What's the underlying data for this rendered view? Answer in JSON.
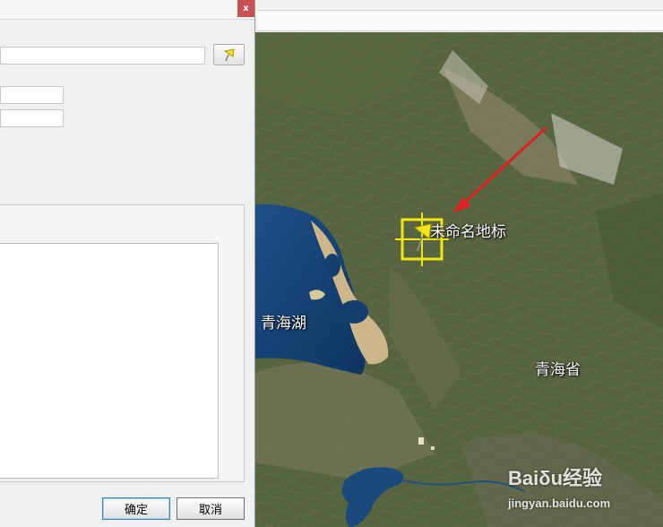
{
  "dialog": {
    "close_label": "x",
    "ok_label": "确定",
    "cancel_label": "取消",
    "pin_icon": "pushpin-icon"
  },
  "map": {
    "placemark_label": "未命名地标",
    "lake_label": "青海湖",
    "province_label": "青海省",
    "placemark_color": "#f2e60a",
    "arrow_color": "#e02020"
  },
  "watermark": {
    "brand": "Baiδu经验",
    "url": "jingyan.baidu.com"
  }
}
